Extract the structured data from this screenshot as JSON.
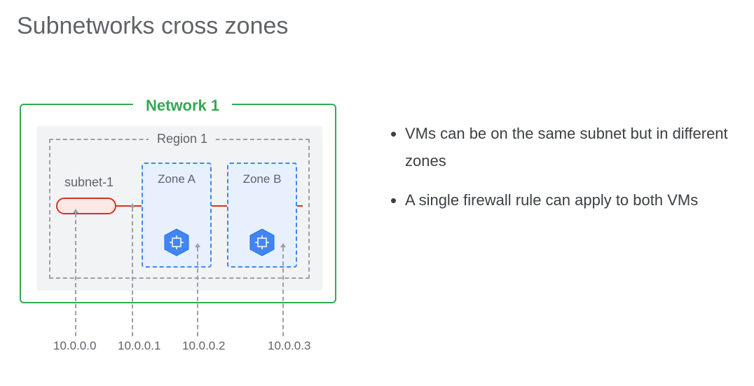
{
  "title": "Subnetworks cross zones",
  "diagram": {
    "network_label": "Network 1",
    "region_label": "Region 1",
    "subnet_label": "subnet-1",
    "zones": {
      "a": "Zone A",
      "b": "Zone B"
    },
    "ips": {
      "subnet": "10.0.0.0",
      "gateway": "10.0.0.1",
      "vm_a": "10.0.0.2",
      "vm_b": "10.0.0.3"
    },
    "icon_name": "compute-chip-icon"
  },
  "bullets": [
    "VMs can be on the same subnet but in different zones",
    "A single firewall rule can apply to both VMs"
  ],
  "colors": {
    "network_border": "#34a853",
    "zone_border": "#4285f4",
    "zone_fill": "#e8f0fe",
    "bus": "#d93025",
    "subnet_fill": "#fce8e6",
    "region_fill": "#f1f3f4",
    "dash": "#9aa0a6"
  }
}
